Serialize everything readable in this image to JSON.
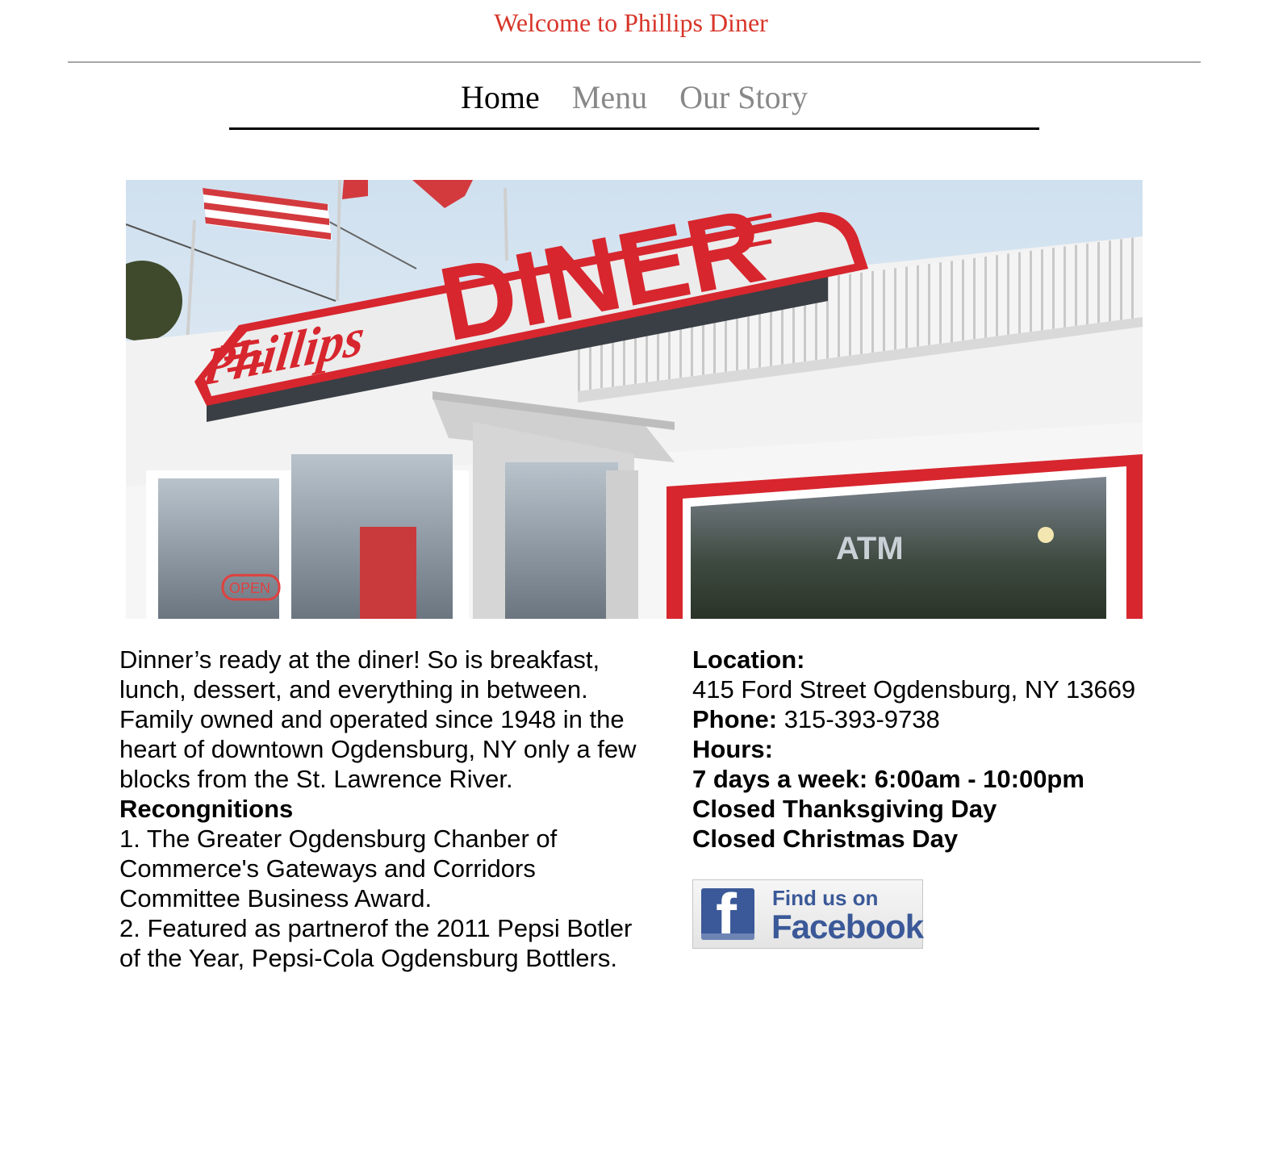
{
  "header": {
    "welcome": "Welcome to Phillips Diner"
  },
  "nav": [
    {
      "label": "Home",
      "active": true
    },
    {
      "label": "Menu",
      "active": false
    },
    {
      "label": "Our Story",
      "active": false
    }
  ],
  "hero": {
    "sign_script": "Phillips",
    "sign_main": "DINER",
    "atm_text": "ATM",
    "open_text": "OPEN"
  },
  "about": {
    "intro": "Dinner’s ready at the diner! So is breakfast, lunch, dessert, and everything in between. Family owned and operated since 1948 in the heart of downtown Ogdensburg, NY only a few blocks from the St. Lawrence River.",
    "recognitions_heading": "Recongnitions",
    "recognitions": [
      "1. The Greater Ogdensburg Chanber of Commerce's Gateways and Corridors Committee Business Award.",
      "2. Featured as partnerof the 2011 Pepsi Botler of the Year, Pepsi-Cola Ogdensburg Bottlers."
    ]
  },
  "info": {
    "location_label": "Location:",
    "address": "415 Ford Street Ogdensburg, NY 13669",
    "phone_label": "Phone:",
    "phone": "315-393-9738",
    "hours_label": "Hours:",
    "hours": [
      "7 days a week: 6:00am - 10:00pm",
      "Closed Thanksgiving Day",
      "Closed Christmas Day"
    ]
  },
  "facebook": {
    "line1": "Find us on",
    "line2": "Facebook"
  },
  "colors": {
    "welcome_red": "#d8352a",
    "nav_inactive": "#888888",
    "facebook_blue": "#3b5998"
  }
}
